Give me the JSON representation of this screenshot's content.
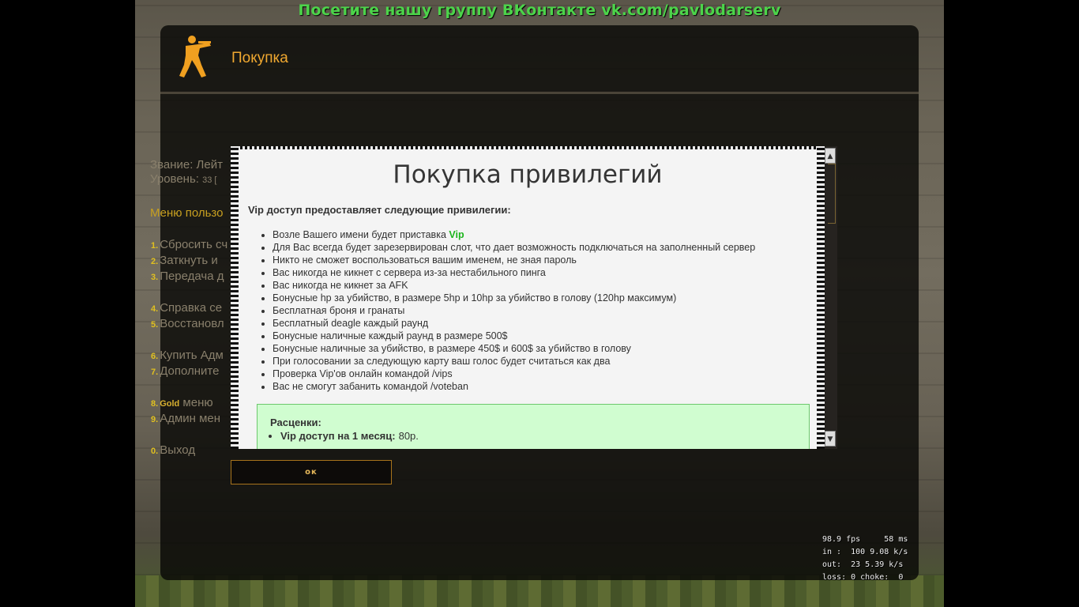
{
  "banner": {
    "text": "Посетите нашу группу ВКонтакте vk.com/pavlodarserv"
  },
  "panel": {
    "title": "Покупка"
  },
  "player_stats": {
    "rank": "Звание: Лейт",
    "level_label": "Уровень:",
    "level_value": "33 [",
    "rank_full_hidden": ""
  },
  "menu": {
    "header": "Меню пользо",
    "items": [
      {
        "num": "1.",
        "label": "Сбросить сч"
      },
      {
        "num": "2.",
        "label": "Заткнуть и"
      },
      {
        "num": "3.",
        "label": "Передача д"
      },
      {
        "num": "4.",
        "label": "Справка се"
      },
      {
        "num": "5.",
        "label": "Восстановл"
      },
      {
        "num": "6.",
        "label": "Купить Адм"
      },
      {
        "num": "7.",
        "label": "Дополните"
      },
      {
        "num": "8.",
        "gold": "Gold",
        "label": " меню"
      },
      {
        "num": "9.",
        "label": "Админ мен"
      },
      {
        "num": "0.",
        "label": "Выход"
      }
    ]
  },
  "dialog": {
    "title": "Покупка привилегий",
    "intro": "Vip доступ предоставляет следующие привилегии:",
    "privileges": [
      {
        "text": "Возле Вашего имени будет приставка ",
        "highlight": "Vip"
      },
      {
        "text": "Для Вас всегда будет зарезервирован слот, что дает возможность подключаться на заполненный сервер"
      },
      {
        "text": "Никто не сможет воспользоваться вашим именем, не зная пароль"
      },
      {
        "text": "Вас никогда не кикнет с сервера из-за нестабильного пинга"
      },
      {
        "text": "Вас никогда не кикнет за AFK"
      },
      {
        "text": "Бонусные hp за убийство, в размере 5hp и 10hp за убийство в голову (120hp максимум)"
      },
      {
        "text": "Бесплатная броня и гранаты"
      },
      {
        "text": "Бесплатный deagle каждый раунд"
      },
      {
        "text": "Бонусные наличные каждый раунд в размере 500$"
      },
      {
        "text": "Бонусные наличные за убийство, в размере 450$ и 600$ за убийство в голову"
      },
      {
        "text": "При голосовании за следующую карту ваш голос будет считаться как два"
      },
      {
        "text": "Проверка Vip'ов онлайн командой /vips"
      },
      {
        "text": "Вас не смогут забанить командой /voteban"
      }
    ],
    "prices": {
      "title": "Расценки:",
      "items": [
        {
          "name": "Vip доступ на 1 месяц:",
          "price": "80р."
        }
      ]
    },
    "ok_label": "ок"
  },
  "netgraph": {
    "line1": "98.9 fps     58 ms",
    "line2": "in :  100 9.08 k/s",
    "line3": "out:  23 5.39 k/s",
    "line4": "loss: 0 choke:  0"
  },
  "colors": {
    "banner_green": "#4cd44a",
    "title_orange": "#f0a830",
    "vip_green": "#1db51d",
    "prices_bg": "#d0fdd0",
    "ok_border": "#a8741c"
  },
  "icons": {
    "logo": "counter-strike-soldier-icon",
    "scroll_up": "arrow-up-icon",
    "scroll_down": "arrow-down-icon"
  }
}
